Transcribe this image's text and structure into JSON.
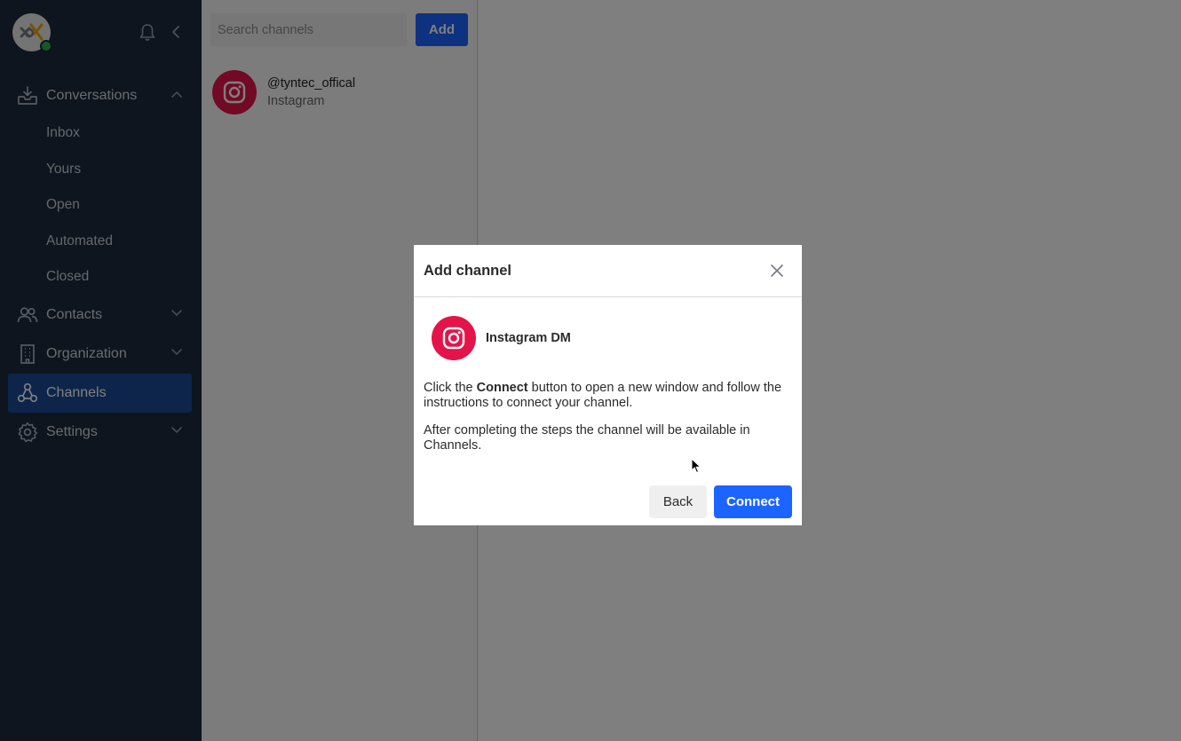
{
  "sidebar": {
    "nav": [
      {
        "label": "Conversations",
        "icon": "inbox-tray-icon",
        "expanded": true
      },
      {
        "label": "Contacts",
        "icon": "people-icon"
      },
      {
        "label": "Organization",
        "icon": "building-icon"
      },
      {
        "label": "Channels",
        "icon": "channels-network-icon",
        "active": true
      },
      {
        "label": "Settings",
        "icon": "gear-icon"
      }
    ],
    "conversation_items": [
      "Inbox",
      "Yours",
      "Open",
      "Automated",
      "Closed"
    ]
  },
  "channels_panel": {
    "search_placeholder": "Search channels",
    "add_label": "Add",
    "items": [
      {
        "handle": "@tyntec_offical",
        "type": "Instagram"
      }
    ]
  },
  "modal": {
    "title": "Add channel",
    "channel_name": "Instagram DM",
    "text1_pre": "Click the ",
    "text1_bold": "Connect",
    "text1_post": " button to open a new window and follow the instructions to connect your channel.",
    "text2": "After completing the steps the channel will be available in Channels.",
    "back_label": "Back",
    "connect_label": "Connect"
  },
  "colors": {
    "sidebar_bg": "#1d2a3f",
    "active_item": "#1a4a94",
    "accent": "#1c64ff",
    "instagram": "#e4144a",
    "online": "#2fb344"
  }
}
